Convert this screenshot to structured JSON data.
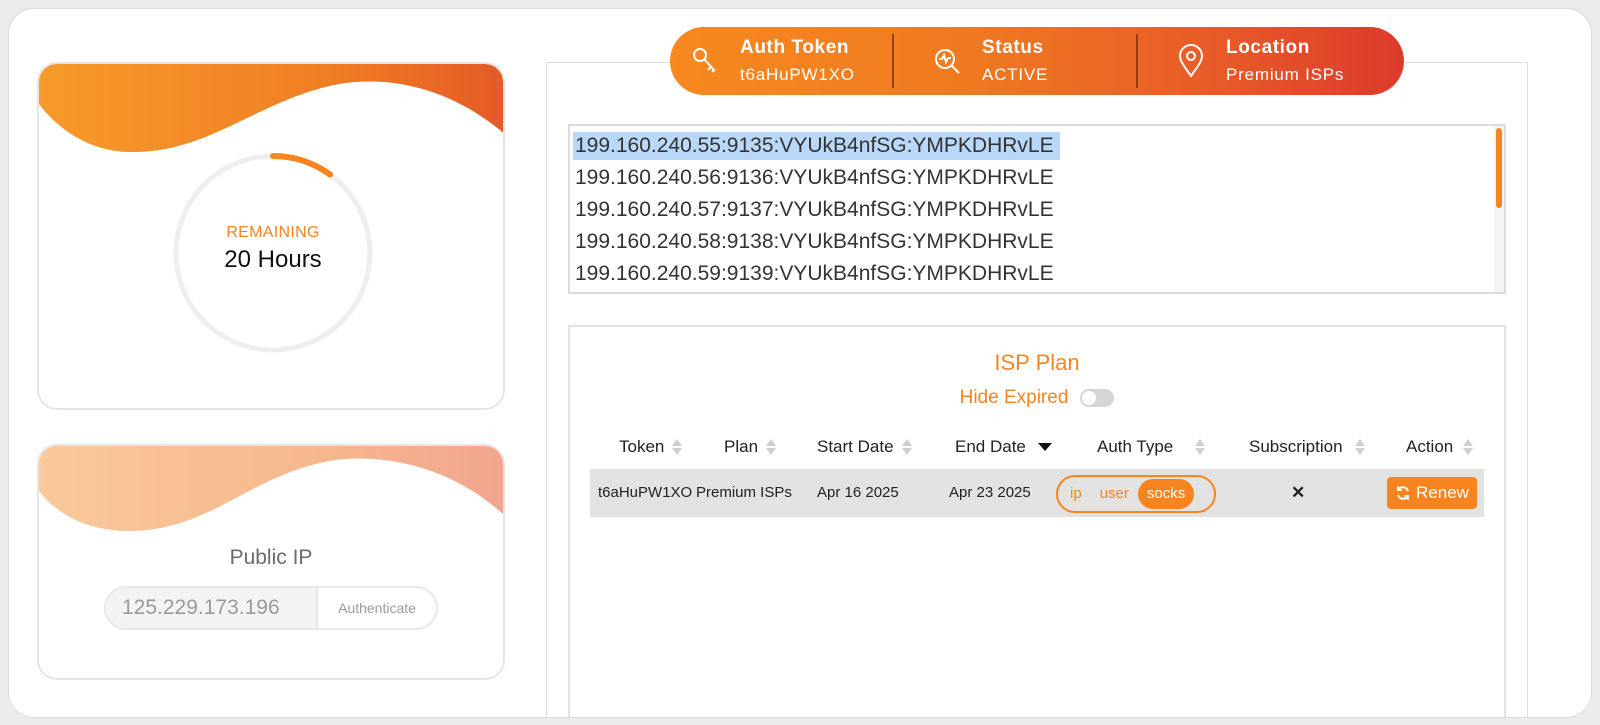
{
  "remaining": {
    "label": "REMAINING",
    "value": "20 Hours",
    "progress_fraction": 0.1
  },
  "public_ip": {
    "title": "Public IP",
    "value": "125.229.173.196",
    "button_label": "Authenticate"
  },
  "info_bar": {
    "auth_token": {
      "title": "Auth Token",
      "value": "t6aHuPW1XO",
      "icon": "key-icon"
    },
    "status": {
      "title": "Status",
      "value": "ACTIVE",
      "icon": "search-chart-icon"
    },
    "location": {
      "title": "Location",
      "value": "Premium ISPs",
      "icon": "location-pin-icon"
    }
  },
  "proxy_list": [
    "199.160.240.55:9135:VYUkB4nfSG:YMPKDHRvLE",
    "199.160.240.56:9136:VYUkB4nfSG:YMPKDHRvLE",
    "199.160.240.57:9137:VYUkB4nfSG:YMPKDHRvLE",
    "199.160.240.58:9138:VYUkB4nfSG:YMPKDHRvLE",
    "199.160.240.59:9139:VYUkB4nfSG:YMPKDHRvLE"
  ],
  "plan": {
    "title": "ISP Plan",
    "hide_expired_label": "Hide Expired",
    "hide_expired_on": false,
    "columns": [
      "Token",
      "Plan",
      "Start Date",
      "End Date",
      "Auth Type",
      "Subscription",
      "Action"
    ],
    "rows": [
      {
        "token": "t6aHuPW1XO",
        "plan": "Premium ISPs",
        "start_date": "Apr 16 2025",
        "end_date": "Apr 23 2025",
        "auth_options": [
          "ip",
          "user",
          "socks"
        ],
        "auth_selected": "socks",
        "subscription": "✕",
        "action_label": "Renew"
      }
    ]
  },
  "colors": {
    "accent": "#f7841e",
    "gradient_end": "#dc3a2c"
  }
}
